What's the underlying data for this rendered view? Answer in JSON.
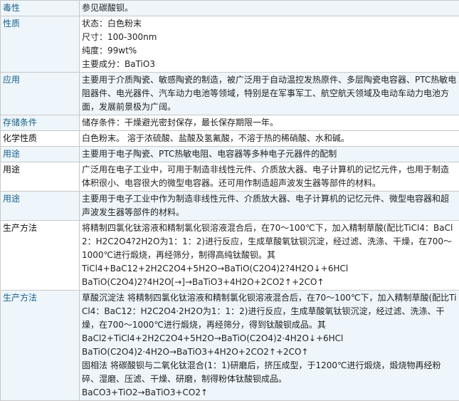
{
  "rows": [
    {
      "label": "毒性",
      "lines": [
        "参见碳酸钡。"
      ]
    },
    {
      "label": "性质",
      "lines": [
        "状态：白色粉末",
        "尺寸：100-300nm",
        "纯度：99wt%",
        "主要成分：BaTiO3"
      ]
    },
    {
      "label": "应用",
      "lines": [
        "主要用于介质陶瓷、敏感陶瓷的制造，被广泛用于自动温控发热原件、多层陶瓷电容器、PTC热敏电阻器件、电光器件、汽车动力电池等领域，特别是在军事军工、航空航天领域及电动车动力电池方面，发展前景极为广阔。"
      ]
    },
    {
      "label": "存储条件",
      "lines": [
        "储存条件：干燥避光密封保存，最长保存期限一年。"
      ]
    },
    {
      "label": "化学性质",
      "lines": [
        "白色粉末。 溶于浓硫酸、盐酸及氢氟酸，不溶于热的稀硝酸、水和碱。"
      ]
    },
    {
      "label": "用途",
      "lines": [
        "主要用于电子陶瓷、PTC热敏电阻、电容器等多种电子元器件的配制"
      ]
    },
    {
      "label": "用途",
      "lines": [
        "广泛用在电子工业中，可用于制造非线性元件、介质放大器、电子计算机的记忆元件，也用于制造体积很小、电容很大的微型电容器。还可用作制造超声波发生器等部件的材料。"
      ]
    },
    {
      "label": "用途",
      "lines": [
        "主要用于电子工业中作为制造非线性元件、介质放大器、电子计算机的记忆元件、微型电容器和超声波发生器等部件的材料。"
      ]
    },
    {
      "label": "生产方法",
      "lines": [
        "将精制四氯化钛溶液和精制氯化钡溶液混合后，在70～100℃下，加入精制草酸(配比TiCl4：BaCl2：H2C2O4?2H2O为1：1：2)进行反应，生成草酸氧钛钡沉淀，经过滤、洗涤、干燥，在700～1000℃进行煅烧，再经筛分，制得高纯钛酸钡。其",
        "TiCl4+BaC12+2H2C2O4+5H2O→BaTiO(C2O4)2?4H2O↓+6HCl",
        "BaTiO(C2O4)2?4H2O[→]→BaTiO3+4H2O+2CO2↑+2CO↑"
      ]
    },
    {
      "label": "生产方法",
      "lines": [
        "草酸沉淀法 将精制四氯化钛溶液和精制氯化钡溶液混合后，在70～100℃下，加入精制草酸(配比TiCl4：BaC12：H2C2O4·2H2O为1：1：2)进行反应，生成草酸氧钛钡沉淀，经过滤、洗涤、干燥，在700～1000℃进行煅烧，再经筛分，得到钛酸钡成品。其",
        "BaCl2+TiCl4+2H2C2O4+5H2O→BaTiO(C2O4)2·4H2O↓+6HCl",
        "BaTiO(C2O4)2·4H2O→BaTiO3+4H2O+2CO2↑+2CO↑",
        "固相法 将碳酸钡与二氧化钛混合(1：1)研磨后，挤压成型，于1200℃进行煅烧，煅烧物再经粉碎、湿磨、压滤、干燥、研磨，制得粉体钛酸钡成品。",
        "BaCO3+TiO2→BaTiO3+CO2↑"
      ]
    }
  ]
}
